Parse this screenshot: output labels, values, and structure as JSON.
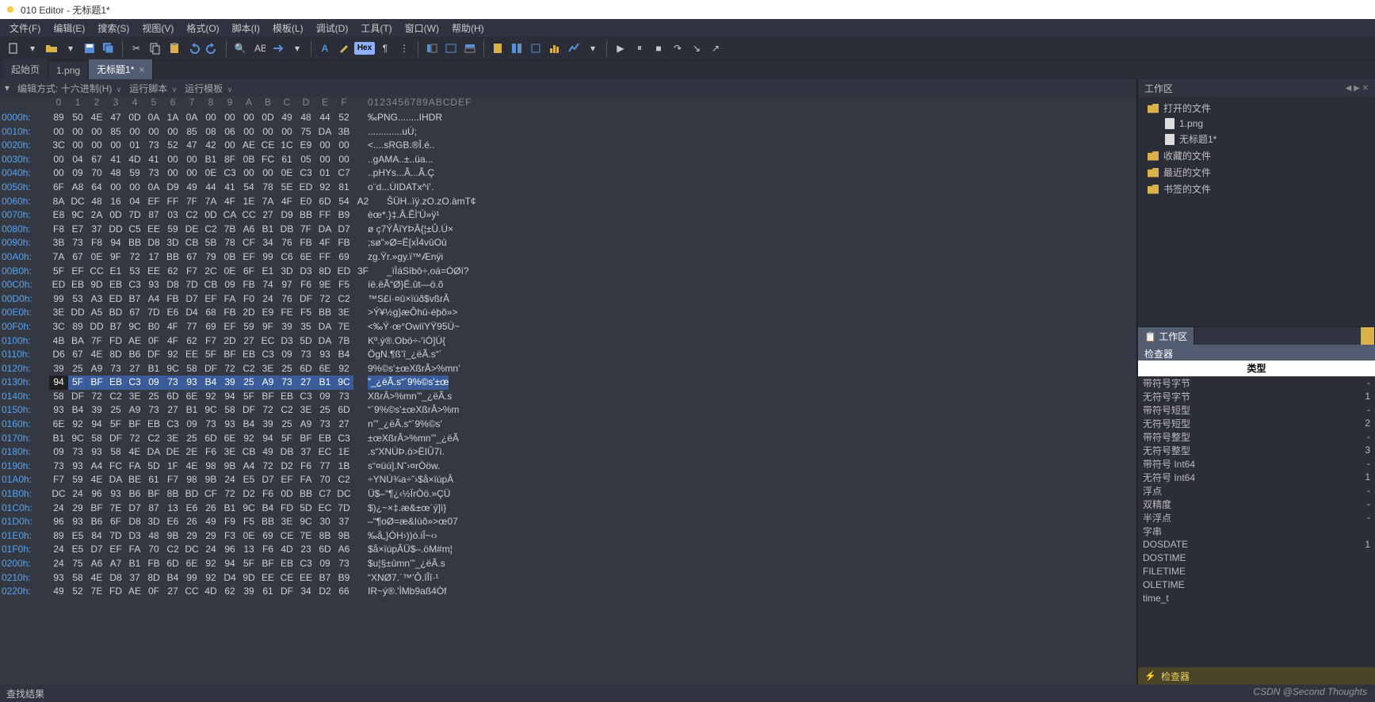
{
  "title": "010 Editor - 无标题1*",
  "menu": [
    "文件(F)",
    "编辑(E)",
    "搜索(S)",
    "视图(V)",
    "格式(O)",
    "脚本(I)",
    "模板(L)",
    "调试(D)",
    "工具(T)",
    "窗口(W)",
    "帮助(H)"
  ],
  "tabs": [
    {
      "label": "起始页",
      "active": false,
      "closable": false
    },
    {
      "label": "1.png",
      "active": false,
      "closable": false
    },
    {
      "label": "无标题1*",
      "active": true,
      "closable": true
    }
  ],
  "editHeader": {
    "mode_label": "编辑方式: 十六进制(H)",
    "script_label": "运行脚本",
    "template_label": "运行模板"
  },
  "ruler": {
    "cols": [
      "0",
      "1",
      "2",
      "3",
      "4",
      "5",
      "6",
      "7",
      "8",
      "9",
      "A",
      "B",
      "C",
      "D",
      "E",
      "F"
    ],
    "ascii": "0123456789ABCDEF"
  },
  "hex_rows": [
    {
      "o": "0000h:",
      "b": [
        "89",
        "50",
        "4E",
        "47",
        "0D",
        "0A",
        "1A",
        "0A",
        "00",
        "00",
        "00",
        "0D",
        "49",
        "48",
        "44",
        "52"
      ],
      "a": "‰PNG........IHDR"
    },
    {
      "o": "0010h:",
      "b": [
        "00",
        "00",
        "00",
        "85",
        "00",
        "00",
        "00",
        "85",
        "08",
        "06",
        "00",
        "00",
        "00",
        "75",
        "DA",
        "3B"
      ],
      "a": ".............uÚ;"
    },
    {
      "o": "0020h:",
      "b": [
        "3C",
        "00",
        "00",
        "00",
        "01",
        "73",
        "52",
        "47",
        "42",
        "00",
        "AE",
        "CE",
        "1C",
        "E9",
        "00",
        "00"
      ],
      "a": "<....sRGB.®Î.é.."
    },
    {
      "o": "0030h:",
      "b": [
        "00",
        "04",
        "67",
        "41",
        "4D",
        "41",
        "00",
        "00",
        "B1",
        "8F",
        "0B",
        "FC",
        "61",
        "05",
        "00",
        "00"
      ],
      "a": "..gAMA..±..üa..."
    },
    {
      "o": "0040h:",
      "b": [
        "00",
        "09",
        "70",
        "48",
        "59",
        "73",
        "00",
        "00",
        "0E",
        "C3",
        "00",
        "00",
        "0E",
        "C3",
        "01",
        "C7"
      ],
      "a": "..pHYs...Ã...Ã.Ç"
    },
    {
      "o": "0050h:",
      "b": [
        "6F",
        "A8",
        "64",
        "00",
        "00",
        "0A",
        "D9",
        "49",
        "44",
        "41",
        "54",
        "78",
        "5E",
        "ED",
        "92",
        "81"
      ],
      "a": "o¨d...ÙIDATx^í’."
    },
    {
      "o": "0060h:",
      "b": [
        "8A",
        "DC",
        "48",
        "16",
        "04",
        "EF",
        "FF",
        "7F",
        "7A",
        "4F",
        "1E",
        "7A",
        "4F",
        "E0",
        "6D",
        "54",
        "A2"
      ],
      "a": "ŠÜH..ïÿ.zO.zO.àmT¢"
    },
    {
      "o": "0070h:",
      "b": [
        "E8",
        "9C",
        "2A",
        "0D",
        "7D",
        "87",
        "03",
        "C2",
        "0D",
        "CA",
        "CC",
        "27",
        "D9",
        "BB",
        "FF",
        "B9"
      ],
      "a": "èœ*.}‡.Â.ÊÌ'Ù»ÿ¹"
    },
    {
      "o": "0080h:",
      "b": [
        "F8",
        "E7",
        "37",
        "DD",
        "C5",
        "EE",
        "59",
        "DE",
        "C2",
        "7B",
        "A6",
        "B1",
        "DB",
        "7F",
        "DA",
        "D7"
      ],
      "a": "ø ç7ÝÅîYÞÂ{¦±Û.Ú×"
    },
    {
      "o": "0090h:",
      "b": [
        "3B",
        "73",
        "F8",
        "94",
        "BB",
        "D8",
        "3D",
        "CB",
        "5B",
        "78",
        "CF",
        "34",
        "76",
        "FB",
        "4F",
        "FB"
      ],
      "a": ";sø”»Ø=Ë[xÏ4vûOû"
    },
    {
      "o": "00A0h:",
      "b": [
        "7A",
        "67",
        "0E",
        "9F",
        "72",
        "17",
        "BB",
        "67",
        "79",
        "0B",
        "EF",
        "99",
        "C6",
        "6E",
        "FF",
        "69"
      ],
      "a": "zg.Ÿr.»gy.ï™Ænÿi"
    },
    {
      "o": "00B0h:",
      "b": [
        "5F",
        "EF",
        "CC",
        "E1",
        "53",
        "EE",
        "62",
        "F7",
        "2C",
        "0E",
        "6F",
        "E1",
        "3D",
        "D3",
        "8D",
        "ED",
        "3F"
      ],
      "a": "_ïÌáSîbô÷,oá=ÓØí?"
    },
    {
      "o": "00C0h:",
      "b": [
        "ED",
        "EB",
        "9D",
        "EB",
        "C3",
        "93",
        "D8",
        "7D",
        "CB",
        "09",
        "FB",
        "74",
        "97",
        "F6",
        "9E",
        "F5"
      ],
      "a": "íë.ëÃ“Ø}Ë.ût—ö.õ"
    },
    {
      "o": "00D0h:",
      "b": [
        "99",
        "53",
        "A3",
        "ED",
        "B7",
        "A4",
        "FB",
        "D7",
        "EF",
        "FA",
        "F0",
        "24",
        "76",
        "DF",
        "72",
        "C2"
      ],
      "a": "™S£í·¤û×ïúð$vßrÂ"
    },
    {
      "o": "00E0h:",
      "b": [
        "3E",
        "DD",
        "A5",
        "BD",
        "67",
        "7D",
        "E6",
        "D4",
        "68",
        "FB",
        "2D",
        "E9",
        "FE",
        "F5",
        "BB",
        "3E"
      ],
      "a": ">Ý¥½g}æÔhû-éþõ»>"
    },
    {
      "o": "00F0h:",
      "b": [
        "3C",
        "89",
        "DD",
        "B7",
        "9C",
        "B0",
        "4F",
        "77",
        "69",
        "EF",
        "59",
        "9F",
        "39",
        "35",
        "DA",
        "7E"
      ],
      "a": "<‰Ý·œ°OwiïYŸ95Ú~"
    },
    {
      "o": "0100h:",
      "b": [
        "4B",
        "BA",
        "7F",
        "FD",
        "AE",
        "0F",
        "4F",
        "62",
        "F7",
        "2D",
        "27",
        "EC",
        "D3",
        "5D",
        "DA",
        "7B"
      ],
      "a": "Kº.ý®.Obö÷-'ìÓ]Ú{"
    },
    {
      "o": "0110h:",
      "b": [
        "D6",
        "67",
        "4E",
        "8D",
        "B6",
        "DF",
        "92",
        "EE",
        "5F",
        "BF",
        "EB",
        "C3",
        "09",
        "73",
        "93",
        "B4"
      ],
      "a": "ÖgN.¶ß’î_¿ëÃ.s“´"
    },
    {
      "o": "0120h:",
      "b": [
        "39",
        "25",
        "A9",
        "73",
        "27",
        "B1",
        "9C",
        "58",
        "DF",
        "72",
        "C2",
        "3E",
        "25",
        "6D",
        "6E",
        "92"
      ],
      "a": "9%©s'±œXßrÂ>%mn’"
    },
    {
      "o": "0130h:",
      "b": [
        "94",
        "5F",
        "BF",
        "EB",
        "C3",
        "09",
        "73",
        "93",
        "B4",
        "39",
        "25",
        "A9",
        "73",
        "27",
        "B1",
        "9C"
      ],
      "a": "”_¿ëÃ.s“´9%©s'±œ",
      "sel": true
    },
    {
      "o": "0140h:",
      "b": [
        "58",
        "DF",
        "72",
        "C2",
        "3E",
        "25",
        "6D",
        "6E",
        "92",
        "94",
        "5F",
        "BF",
        "EB",
        "C3",
        "09",
        "73"
      ],
      "a": "XßrÂ>%mn’”_¿ëÃ.s"
    },
    {
      "o": "0150h:",
      "b": [
        "93",
        "B4",
        "39",
        "25",
        "A9",
        "73",
        "27",
        "B1",
        "9C",
        "58",
        "DF",
        "72",
        "C2",
        "3E",
        "25",
        "6D"
      ],
      "a": "“´9%©s'±œXßrÂ>%m"
    },
    {
      "o": "0160h:",
      "b": [
        "6E",
        "92",
        "94",
        "5F",
        "BF",
        "EB",
        "C3",
        "09",
        "73",
        "93",
        "B4",
        "39",
        "25",
        "A9",
        "73",
        "27"
      ],
      "a": "n’”_¿ëÃ.s“´9%©s'"
    },
    {
      "o": "0170h:",
      "b": [
        "B1",
        "9C",
        "58",
        "DF",
        "72",
        "C2",
        "3E",
        "25",
        "6D",
        "6E",
        "92",
        "94",
        "5F",
        "BF",
        "EB",
        "C3"
      ],
      "a": "±œXßrÂ>%mn’”_¿ëÃ"
    },
    {
      "o": "0180h:",
      "b": [
        "09",
        "73",
        "93",
        "58",
        "4E",
        "DA",
        "DE",
        "2E",
        "F6",
        "3E",
        "CB",
        "49",
        "DB",
        "37",
        "EC",
        "1E"
      ],
      "a": ".s“XNÚÞ.ö>ËIÛ7ì."
    },
    {
      "o": "0190h:",
      "b": [
        "73",
        "93",
        "A4",
        "FC",
        "FA",
        "5D",
        "1F",
        "4E",
        "98",
        "9B",
        "A4",
        "72",
        "D2",
        "F6",
        "77",
        "1B"
      ],
      "a": "s“¤üú].N˜›¤rÒöw."
    },
    {
      "o": "01A0h:",
      "b": [
        "F7",
        "59",
        "4E",
        "DA",
        "BE",
        "61",
        "F7",
        "98",
        "9B",
        "24",
        "E5",
        "D7",
        "EF",
        "FA",
        "70",
        "C2"
      ],
      "a": "÷YNÚ¾a÷˜›$å×ïúpÂ"
    },
    {
      "o": "01B0h:",
      "b": [
        "DC",
        "24",
        "96",
        "93",
        "B6",
        "BF",
        "8B",
        "BD",
        "CF",
        "72",
        "D2",
        "F6",
        "0D",
        "BB",
        "C7",
        "DC"
      ],
      "a": "Ü$–“¶¿‹½ÏrÒö.»ÇÜ"
    },
    {
      "o": "01C0h:",
      "b": [
        "24",
        "29",
        "BF",
        "7E",
        "D7",
        "87",
        "13",
        "E6",
        "26",
        "B1",
        "9C",
        "B4",
        "FD",
        "5D",
        "EC",
        "7D"
      ],
      "a": "$)¿~×‡.æ&±œ´ý]ì}"
    },
    {
      "o": "01D0h:",
      "b": [
        "96",
        "93",
        "B6",
        "6F",
        "D8",
        "3D",
        "E6",
        "26",
        "49",
        "F9",
        "F5",
        "BB",
        "3E",
        "9C",
        "30",
        "37"
      ],
      "a": "–“¶oØ=æ&Iùõ»>œ07"
    },
    {
      "o": "01E0h:",
      "b": [
        "89",
        "E5",
        "84",
        "7D",
        "D3",
        "48",
        "9B",
        "29",
        "29",
        "F3",
        "0E",
        "69",
        "CE",
        "7E",
        "8B",
        "9B"
      ],
      "a": "‰å„}ÓH›))ó.iÎ~‹›"
    },
    {
      "o": "01F0h:",
      "b": [
        "24",
        "E5",
        "D7",
        "EF",
        "FA",
        "70",
        "C2",
        "DC",
        "24",
        "96",
        "13",
        "F6",
        "4D",
        "23",
        "6D",
        "A6"
      ],
      "a": "$å×ïúpÂÜ$–.öM#m¦"
    },
    {
      "o": "0200h:",
      "b": [
        "24",
        "75",
        "A6",
        "A7",
        "B1",
        "FB",
        "6D",
        "6E",
        "92",
        "94",
        "5F",
        "BF",
        "EB",
        "C3",
        "09",
        "73"
      ],
      "a": "$u¦§±ûmn’”_¿ëÃ.s"
    },
    {
      "o": "0210h:",
      "b": [
        "93",
        "58",
        "4E",
        "D8",
        "37",
        "8D",
        "B4",
        "99",
        "92",
        "D4",
        "9D",
        "EE",
        "CE",
        "EE",
        "B7",
        "B9"
      ],
      "a": "“XNØ7.´™’Ô.îÎî·¹"
    },
    {
      "o": "0220h:",
      "b": [
        "49",
        "52",
        "7E",
        "FD",
        "AE",
        "0F",
        "27",
        "CC",
        "4D",
        "62",
        "39",
        "61",
        "DF",
        "34",
        "D2",
        "66"
      ],
      "a": "IR~ý®.'ÌMb9aß4Òf"
    }
  ],
  "workspace": {
    "title": "工作区",
    "open": "打开的文件",
    "file1": "1.png",
    "file2": "无标题1*",
    "fav": "收藏的文件",
    "recent": "最近的文件",
    "bookmark": "书签的文件"
  },
  "inspector": {
    "tabs": [
      "工作区"
    ],
    "tab2": "检查器",
    "header": "类型",
    "rows": [
      {
        "k": "带符号字节",
        "v": "-"
      },
      {
        "k": "无符号字节",
        "v": "1"
      },
      {
        "k": "带符号短型",
        "v": "-"
      },
      {
        "k": "无符号短型",
        "v": "2"
      },
      {
        "k": "带符号整型",
        "v": "-"
      },
      {
        "k": "无符号整型",
        "v": "3"
      },
      {
        "k": "带符号 Int64",
        "v": "-"
      },
      {
        "k": "无符号 Int64",
        "v": "1"
      },
      {
        "k": "浮点",
        "v": "-"
      },
      {
        "k": "双精度",
        "v": "-"
      },
      {
        "k": "半浮点",
        "v": "-"
      },
      {
        "k": "字串",
        "v": ""
      },
      {
        "k": "DOSDATE",
        "v": "1"
      },
      {
        "k": "DOSTIME",
        "v": ""
      },
      {
        "k": "FILETIME",
        "v": ""
      },
      {
        "k": "OLETIME",
        "v": ""
      },
      {
        "k": "time_t",
        "v": ""
      }
    ],
    "footer": "检查器"
  },
  "footer": "查找结果",
  "watermark": "CSDN @Second Thoughts"
}
